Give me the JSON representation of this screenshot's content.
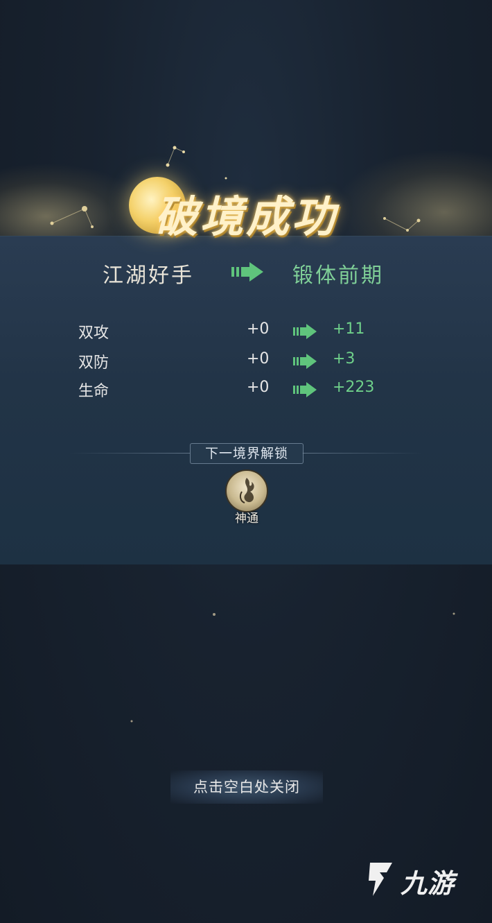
{
  "result": {
    "title": "破境成功",
    "rank_from": "江湖好手",
    "rank_to": "锻体前期"
  },
  "stats": [
    {
      "label": "双攻",
      "before": "+0",
      "after": "+11"
    },
    {
      "label": "双防",
      "before": "+0",
      "after": "+3"
    },
    {
      "label": "生命",
      "before": "+0",
      "after": "+223"
    }
  ],
  "unlock": {
    "header": "下一境界解锁",
    "skill_label": "神通"
  },
  "close_hint": "点击空白处关闭",
  "watermark": {
    "text": "九游",
    "logo_icon": "jiuyou-logo-icon"
  },
  "colors": {
    "accent_green": "#6fd08a",
    "title_gold": "#fff1c9",
    "panel_bg": "#223447"
  }
}
